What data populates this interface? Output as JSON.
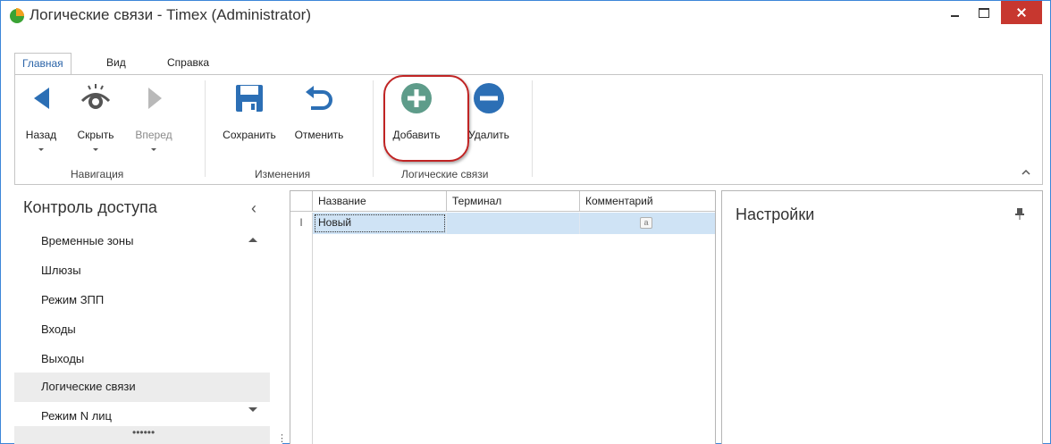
{
  "window": {
    "title": "Логические связи - Timex (Administrator)",
    "accent": "#3c86d8",
    "close_color": "#c7372f"
  },
  "menu_tabs": [
    {
      "label": "Главная",
      "active": true
    },
    {
      "label": "Вид",
      "active": false
    },
    {
      "label": "Справка",
      "active": false
    }
  ],
  "ribbon": {
    "groups": [
      {
        "label": "Навигация",
        "buttons": [
          {
            "label": "Назад",
            "icon": "arrow-left-icon",
            "enabled": true,
            "dropdown": true
          },
          {
            "label": "Скрыть",
            "icon": "eye-icon",
            "enabled": true,
            "dropdown": true
          },
          {
            "label": "Вперед",
            "icon": "arrow-right-icon",
            "enabled": false,
            "dropdown": true
          }
        ]
      },
      {
        "label": "Изменения",
        "buttons": [
          {
            "label": "Сохранить",
            "icon": "save-icon",
            "enabled": true
          },
          {
            "label": "Отменить",
            "icon": "undo-icon",
            "enabled": true
          }
        ]
      },
      {
        "label": "Логические связи",
        "buttons": [
          {
            "label": "Добавить",
            "icon": "add-icon",
            "enabled": true,
            "highlighted": true
          },
          {
            "label": "Удалить",
            "icon": "remove-icon",
            "enabled": true
          }
        ]
      }
    ],
    "highlight_color": "#c02424"
  },
  "left_panel": {
    "title": "Контроль доступа",
    "items": [
      {
        "label": "Временные зоны",
        "selected": false
      },
      {
        "label": "Шлюзы",
        "selected": false
      },
      {
        "label": "Режим ЗПП",
        "selected": false
      },
      {
        "label": "Входы",
        "selected": false
      },
      {
        "label": "Выходы",
        "selected": false
      },
      {
        "label": "Логические связи",
        "selected": true
      },
      {
        "label": "Режим N лиц",
        "selected": false
      }
    ],
    "footer_dots": "••••••"
  },
  "grid": {
    "columns": [
      "Название",
      "Терминал",
      "Комментарий"
    ],
    "rows": [
      {
        "name": "Новый",
        "terminal": "",
        "comment_icon": "memo-icon",
        "comment_glyph": "a"
      }
    ],
    "row_indicator": "I",
    "selection_color": "#cfe3f5"
  },
  "right_panel": {
    "title": "Настройки",
    "pin_icon": "pin-icon"
  }
}
